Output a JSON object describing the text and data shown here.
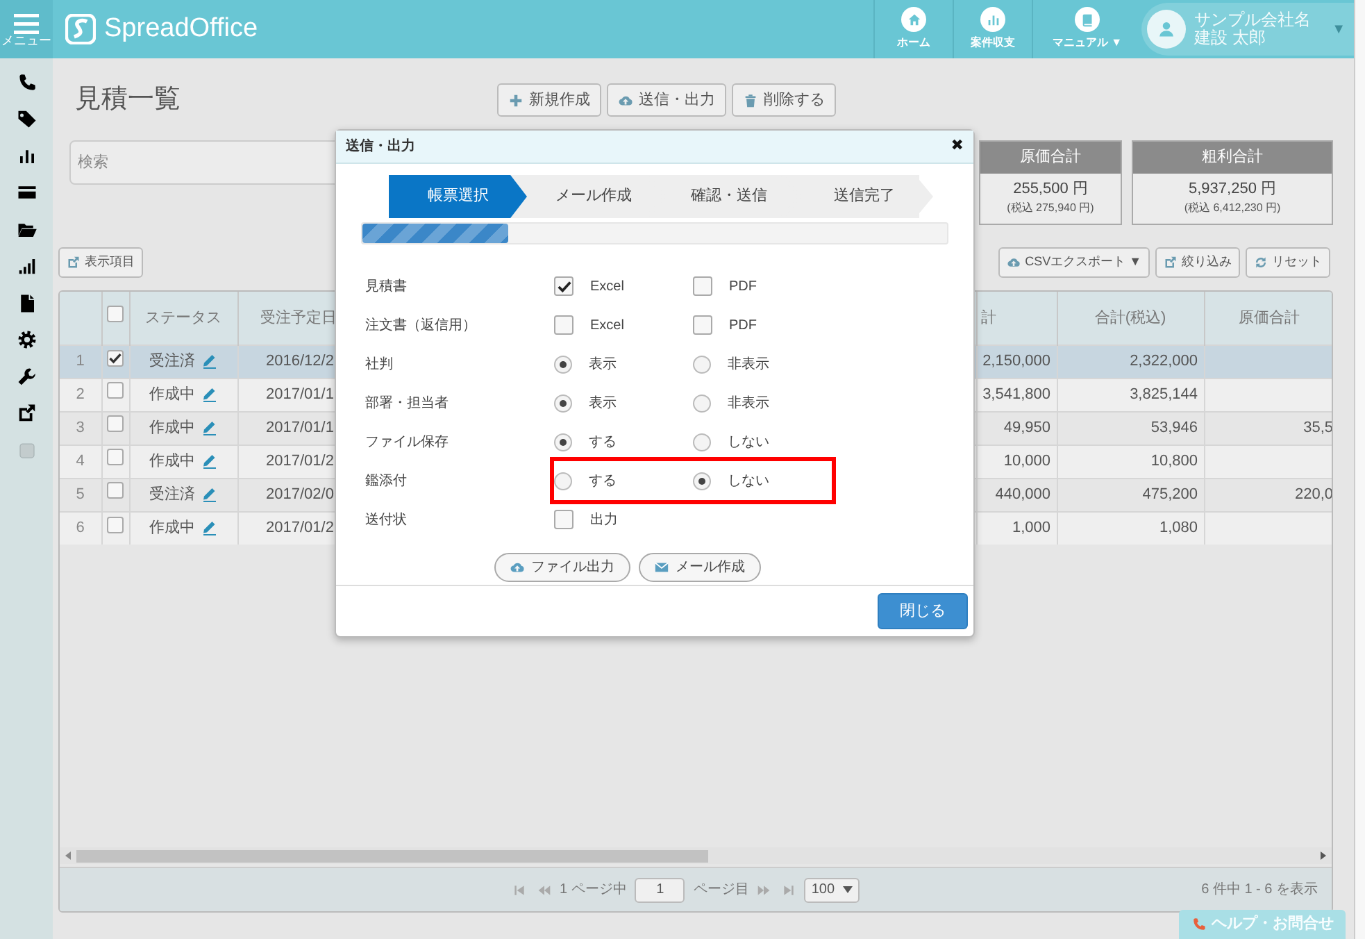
{
  "nav": {
    "menu_label": "メニュー",
    "logo": "SpreadOffice",
    "links": [
      {
        "label": "ホーム",
        "kind": "home"
      },
      {
        "label": "案件収支",
        "kind": "bars"
      },
      {
        "label": "マニュアル ▼",
        "kind": "book"
      }
    ],
    "user": {
      "company": "サンプル会社名",
      "name": "建設 太郎",
      "caret": "▼"
    }
  },
  "sidebar": {
    "items": [
      {
        "kind": "phone"
      },
      {
        "kind": "tag"
      },
      {
        "kind": "bars"
      },
      {
        "kind": "card"
      },
      {
        "kind": "folder"
      },
      {
        "kind": "signal"
      },
      {
        "kind": "doc"
      },
      {
        "kind": "gear"
      },
      {
        "kind": "wrench"
      },
      {
        "kind": "external"
      },
      {
        "kind": "box"
      }
    ]
  },
  "page": {
    "title": "見積一覧",
    "actions": [
      {
        "label": "新規作成",
        "kind": "plus"
      },
      {
        "label": "送信・出力",
        "kind": "cloud"
      },
      {
        "label": "削除する",
        "kind": "trash"
      }
    ]
  },
  "search": {
    "placeholder": "検索"
  },
  "summary_cards": [
    {
      "title": "原価合計",
      "value": "255,500 円",
      "tax": "(税込 275,940 円)"
    },
    {
      "title": "粗利合計",
      "value": "5,937,250 円",
      "tax": "(税込 6,412,230 円)"
    }
  ],
  "table_tools": {
    "left": [
      {
        "label": "表示項目",
        "kind": "external"
      }
    ],
    "right": [
      {
        "label": "CSVエクスポート ▼",
        "kind": "cloud"
      },
      {
        "label": "絞り込み",
        "kind": "external"
      },
      {
        "label": "リセット",
        "kind": "refresh"
      }
    ]
  },
  "table": {
    "header_checked": false,
    "columns": [
      "ステータス",
      "受注予定日",
      "計",
      "合計(税込)",
      "原価合計"
    ],
    "rows": [
      {
        "no": "1",
        "checked": true,
        "selected": true,
        "status": "受注済",
        "date": "2016/12/2",
        "column_5": "2,150,000",
        "total": "2,322,000"
      },
      {
        "no": "2",
        "checked": false,
        "selected": false,
        "status": "作成中",
        "date": "2017/01/1",
        "column_5": "3,541,800",
        "total": "3,825,144"
      },
      {
        "no": "3",
        "checked": false,
        "selected": false,
        "status": "作成中",
        "date": "2017/01/1",
        "column_5": "49,950",
        "total": "53,946",
        "cost": "35,5"
      },
      {
        "no": "4",
        "checked": false,
        "selected": false,
        "status": "作成中",
        "date": "2017/01/2",
        "column_5": "10,000",
        "total": "10,800"
      },
      {
        "no": "5",
        "checked": false,
        "selected": false,
        "status": "受注済",
        "date": "2017/02/0",
        "column_5": "440,000",
        "total": "475,200",
        "cost": "220,0"
      },
      {
        "no": "6",
        "checked": false,
        "selected": false,
        "status": "作成中",
        "date": "2017/01/2",
        "column_5": "1,000",
        "total": "1,080"
      }
    ]
  },
  "pager": {
    "page_of": "1 ページ中",
    "page": "1",
    "page_suffix": "ページ目",
    "per_page": "100",
    "summary": "6 件中 1 - 6 を表示"
  },
  "help": {
    "label": "ヘルプ・お問合せ"
  },
  "dialog": {
    "title": "送信・出力",
    "close_icon": "✖",
    "steps": [
      {
        "label": "帳票選択",
        "selected": true
      },
      {
        "label": "メール作成",
        "selected": false
      },
      {
        "label": "確認・送信",
        "selected": false
      },
      {
        "label": "送信完了",
        "selected": false
      }
    ],
    "progress": {
      "level": 0.25
    },
    "options": [
      {
        "label": "見積書",
        "kind": "checkbox",
        "highlighted": false,
        "choices": [
          {
            "label": "Excel",
            "checked": true
          },
          {
            "label": "PDF",
            "checked": false
          }
        ]
      },
      {
        "label": "注文書（返信用）",
        "kind": "checkbox",
        "highlighted": false,
        "choices": [
          {
            "label": "Excel",
            "checked": false
          },
          {
            "label": "PDF",
            "checked": false
          }
        ]
      },
      {
        "label": "社判",
        "kind": "radio",
        "highlighted": false,
        "choices": [
          {
            "label": "表示",
            "selected": true
          },
          {
            "label": "非表示",
            "selected": false
          }
        ]
      },
      {
        "label": "部署・担当者",
        "kind": "radio",
        "highlighted": false,
        "choices": [
          {
            "label": "表示",
            "selected": true
          },
          {
            "label": "非表示",
            "selected": false
          }
        ]
      },
      {
        "label": "ファイル保存",
        "kind": "radio",
        "highlighted": false,
        "choices": [
          {
            "label": "する",
            "selected": true
          },
          {
            "label": "しない",
            "selected": false
          }
        ]
      },
      {
        "label": "鑑添付",
        "kind": "radio",
        "highlighted": true,
        "choices": [
          {
            "label": "する",
            "selected": false
          },
          {
            "label": "しない",
            "selected": true
          }
        ]
      },
      {
        "label": "送付状",
        "kind": "checkbox",
        "highlighted": false,
        "choices": [
          {
            "label": "出力",
            "checked": false
          }
        ]
      }
    ],
    "buttons": [
      {
        "label": "ファイル出力",
        "kind": "cloud"
      },
      {
        "label": "メール作成",
        "kind": "mail"
      }
    ],
    "close_button": "閉じる"
  }
}
